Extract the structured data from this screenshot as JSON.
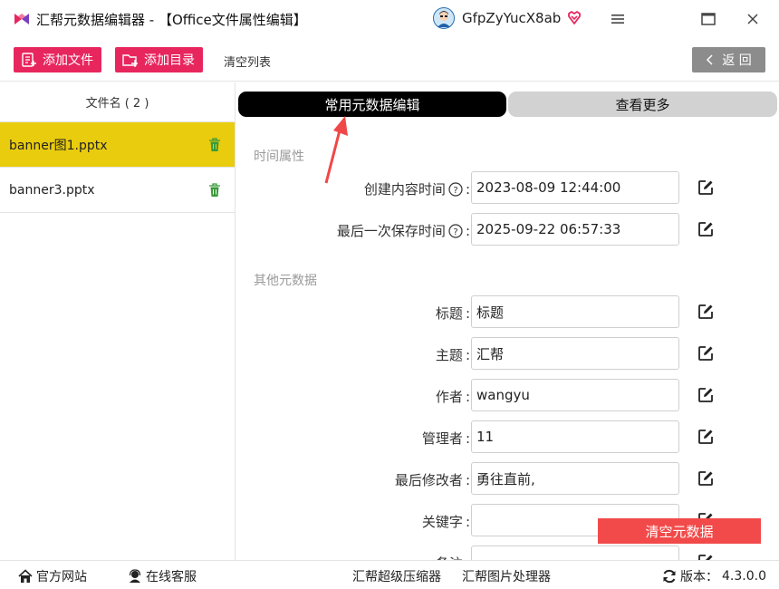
{
  "window": {
    "title": "汇帮元数据编辑器 - 【Office文件属性编辑】",
    "user_name": "GfpZyYucX8ab"
  },
  "toolbar": {
    "add_file": "添加文件",
    "add_dir": "添加目录",
    "clear_list": "清空列表",
    "back": "返 回"
  },
  "sidebar": {
    "header": "文件名 ( 2 )",
    "files": [
      {
        "name": "banner图1.pptx",
        "selected": true
      },
      {
        "name": "banner3.pptx",
        "selected": false
      }
    ]
  },
  "tabs": {
    "common": "常用元数据编辑",
    "more": "查看更多"
  },
  "sections": {
    "time": "时间属性",
    "other": "其他元数据"
  },
  "time_fields": [
    {
      "label": "创建内容时间",
      "value": "2023-08-09 12:44:00"
    },
    {
      "label": "最后一次保存时间",
      "value": "2025-09-22 06:57:33"
    }
  ],
  "other_fields": [
    {
      "label": "标题",
      "value": "标题"
    },
    {
      "label": "主题",
      "value": "汇帮"
    },
    {
      "label": "作者",
      "value": "wangyu"
    },
    {
      "label": "管理者",
      "value": "11"
    },
    {
      "label": "最后修改者",
      "value": "勇往直前,"
    },
    {
      "label": "关键字",
      "value": ""
    },
    {
      "label": "备注",
      "value": ""
    }
  ],
  "label_colon": ":",
  "clear_metadata": "清空元数据",
  "bottombar": {
    "site": "官方网站",
    "service": "在线客服",
    "compressor": "汇帮超级压缩器",
    "image_tool": "汇帮图片处理器",
    "version_label": "版本：",
    "version": "4.3.0.0"
  },
  "colors": {
    "accent_pink": "#e8265e",
    "selected_yellow": "#e9cc0e",
    "clear_red": "#f24a4a",
    "tab_active": "#000000",
    "tab_inactive": "#d2d2d2"
  }
}
